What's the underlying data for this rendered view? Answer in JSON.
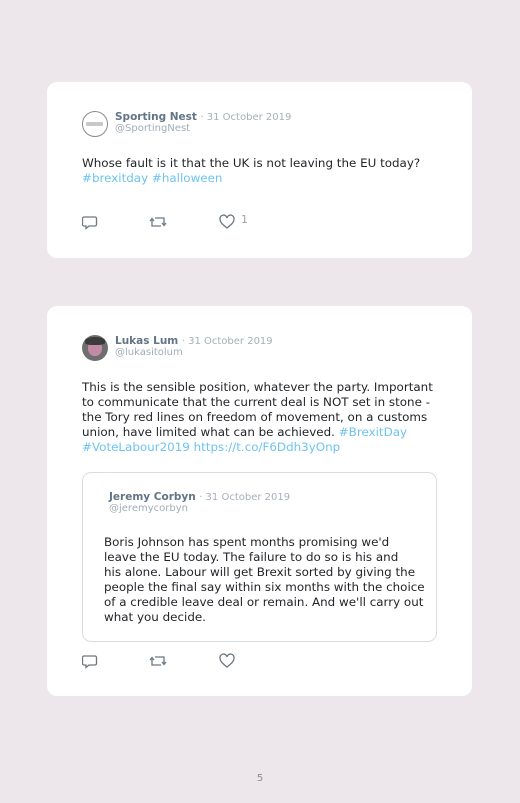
{
  "tweets": [
    {
      "name": "Sporting Nest",
      "date": "· 31 October 2019",
      "handle": "@SportingNest",
      "text_line1": "Whose fault is it that the UK is not leaving the EU today?",
      "hashtags": "#brexitday #halloween",
      "like_count": "1"
    },
    {
      "name": "Lukas Lum",
      "date": "· 31 October 2019",
      "handle": "@lukasitolum",
      "lines": [
        "This is the sensible position, whatever the party. Important",
        "to communicate that the current deal is NOT set in stone -",
        "the Tory red lines on freedom of movement, on a customs",
        "union, have limited what can be achieved. "
      ],
      "tag1": "#BrexitDay",
      "tag2": "#VoteLabour2019 https://t.co/F6Ddh3yOnp",
      "quote": {
        "name": "Jeremy Corbyn",
        "date": "· 31 October 2019",
        "handle": "@jeremycorbyn",
        "lines": [
          "Boris Johnson has spent months promising we'd",
          "leave the EU today. The failure to do so is his and",
          "his alone. Labour will get Brexit sorted by giving the",
          "people the final say within six months with the choice",
          "of a credible leave deal or remain. And we'll carry out",
          "what you decide."
        ]
      }
    }
  ],
  "page_number": "5",
  "icons": [
    "reply-icon",
    "retweet-icon",
    "like-icon"
  ],
  "colors": {
    "hashtag": "#6cc4f0",
    "background": "#ede7ec",
    "card": "#ffffff"
  }
}
